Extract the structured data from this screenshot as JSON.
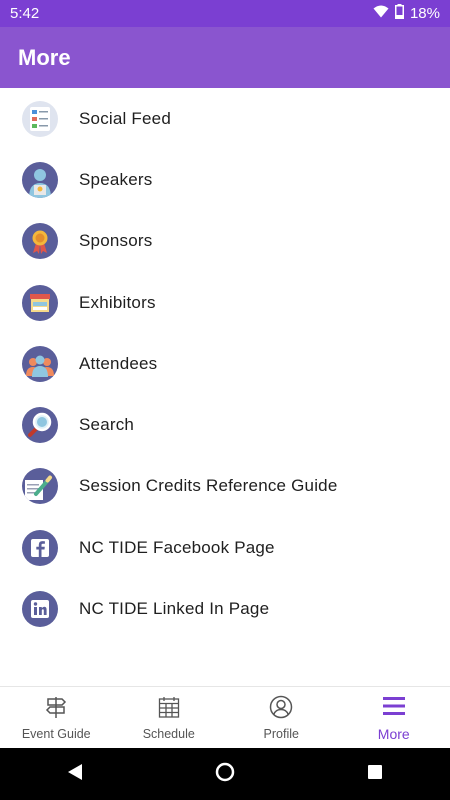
{
  "status_bar": {
    "time": "5:42",
    "battery": "18%"
  },
  "app_bar": {
    "title": "More"
  },
  "menu": {
    "items": [
      {
        "label": "Social Feed",
        "icon": "social-feed-icon"
      },
      {
        "label": "Speakers",
        "icon": "speaker-icon"
      },
      {
        "label": "Sponsors",
        "icon": "award-ribbon-icon"
      },
      {
        "label": "Exhibitors",
        "icon": "exhibitor-booth-icon"
      },
      {
        "label": "Attendees",
        "icon": "attendees-icon"
      },
      {
        "label": "Search",
        "icon": "magnifier-icon"
      },
      {
        "label": "Session Credits Reference Guide",
        "icon": "document-pencil-icon"
      },
      {
        "label": "NC TIDE Facebook Page",
        "icon": "facebook-icon"
      },
      {
        "label": "NC TIDE Linked In Page",
        "icon": "linkedin-icon"
      }
    ]
  },
  "bottom_nav": {
    "items": [
      {
        "label": "Event Guide",
        "icon": "signpost-icon",
        "active": false
      },
      {
        "label": "Schedule",
        "icon": "calendar-icon",
        "active": false
      },
      {
        "label": "Profile",
        "icon": "profile-icon",
        "active": false
      },
      {
        "label": "More",
        "icon": "hamburger-menu-icon",
        "active": true
      }
    ]
  },
  "colors": {
    "status_bar": "#7b3fd2",
    "app_bar": "#8a55cf",
    "accent": "#7b3fd2",
    "icon_circle": "#5a5e9a"
  }
}
